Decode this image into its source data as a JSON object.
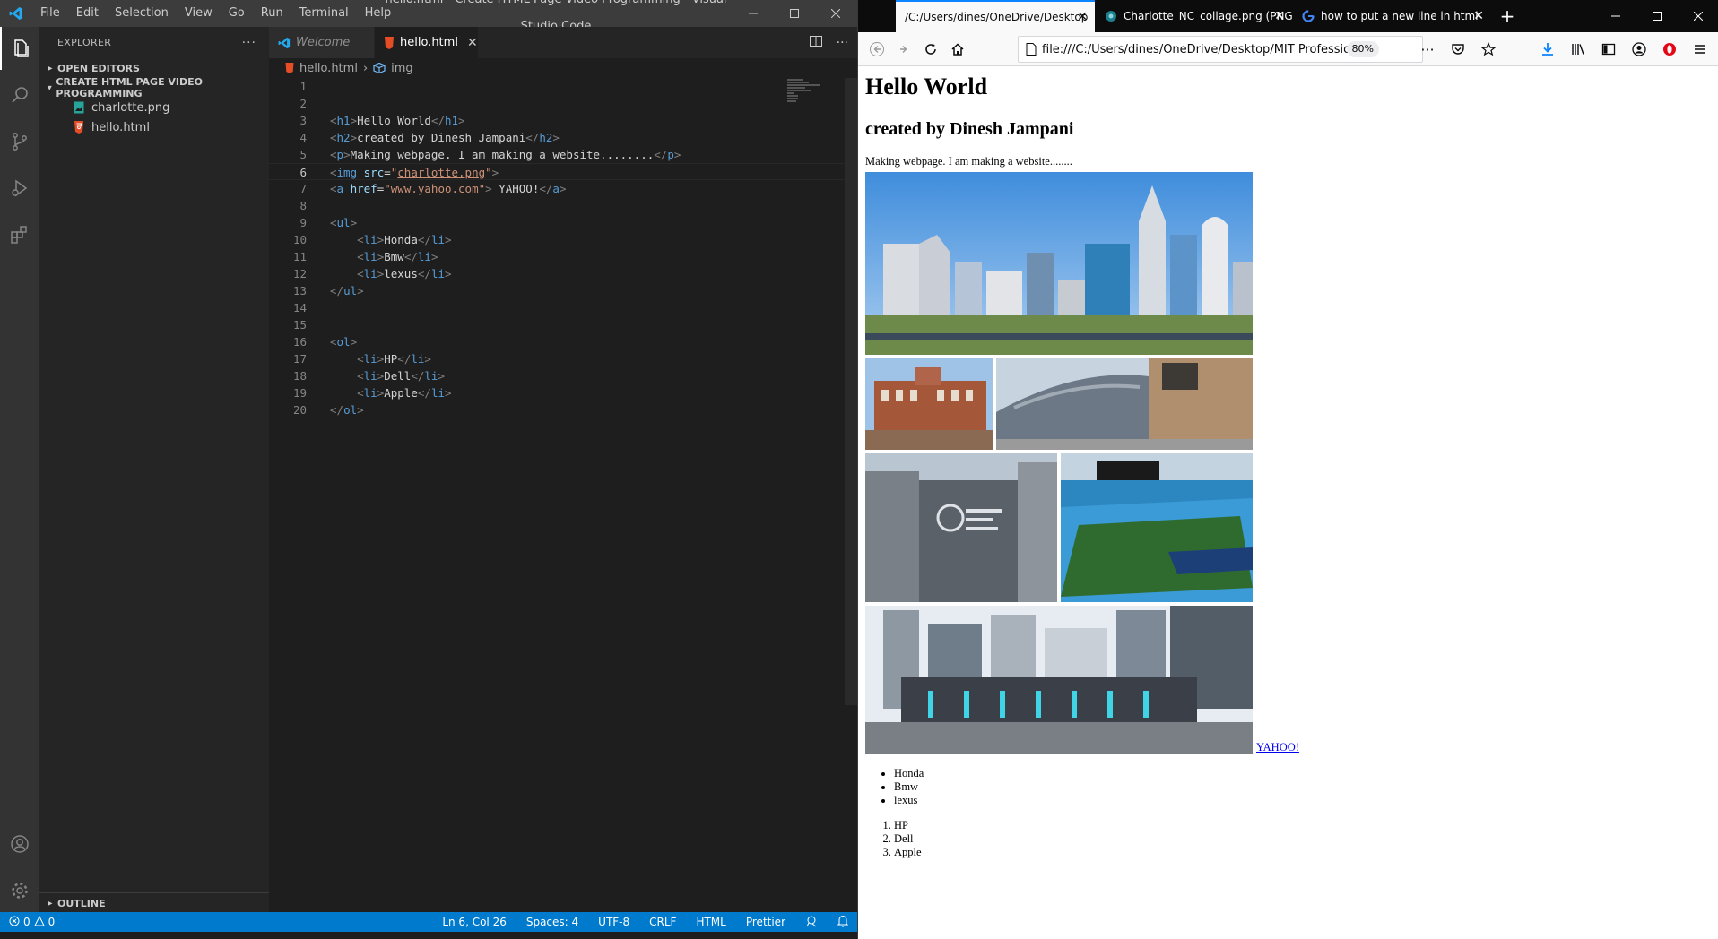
{
  "vscode": {
    "menu": [
      "File",
      "Edit",
      "Selection",
      "View",
      "Go",
      "Run",
      "Terminal",
      "Help"
    ],
    "window_title": "hello.html - Create HTML Page Video Programming - Visual Studio Code",
    "sidebar": {
      "title": "EXPLORER",
      "open_editors": "OPEN EDITORS",
      "project": "CREATE HTML PAGE VIDEO PROGRAMMING",
      "files": [
        {
          "name": "charlotte.png",
          "icon": "image-file-icon"
        },
        {
          "name": "hello.html",
          "icon": "html-file-icon"
        }
      ],
      "outline": "OUTLINE"
    },
    "tabs": [
      {
        "label": "Welcome",
        "active": false
      },
      {
        "label": "hello.html",
        "active": true
      }
    ],
    "breadcrumb": {
      "file": "hello.html",
      "symbol": "img"
    },
    "code": {
      "cursor_line": 6,
      "lines": [
        "",
        "",
        "<h1>Hello World</h1>",
        "<h2>created by Dinesh Jampani</h2>",
        "<p>Making webpage. I am making a website........</p>",
        "<img src=\"charlotte.png\">",
        "<a href=\"www.yahoo.com\"> YAHOO!</a>",
        "",
        "<ul>",
        "    <li>Honda</li>",
        "    <li>Bmw</li>",
        "    <li>lexus</li>",
        "</ul>",
        "",
        "",
        "<ol>",
        "    <li>HP</li>",
        "    <li>Dell</li>",
        "    <li>Apple</li>",
        "</ol>"
      ]
    },
    "status": {
      "errors": "0",
      "warnings": "0",
      "position": "Ln 6, Col 26",
      "spaces": "Spaces: 4",
      "encoding": "UTF-8",
      "eol": "CRLF",
      "language": "HTML",
      "formatter": "Prettier"
    }
  },
  "firefox": {
    "tabs": [
      {
        "label": "/C:/Users/dines/OneDrive/Desktop",
        "active": true
      },
      {
        "label": "Charlotte_NC_collage.png (PNG",
        "active": false
      },
      {
        "label": "how to put a new line in html",
        "active": false
      }
    ],
    "url": "file:///C:/Users/dines/OneDrive/Desktop/MIT Professional",
    "zoom": "80%",
    "page": {
      "h1": "Hello World",
      "h2": "created by Dinesh Jampani",
      "p": "Making webpage. I am making a website........",
      "link": "YAHOO!",
      "ul": [
        "Honda",
        "Bmw",
        "lexus"
      ],
      "ol": [
        "HP",
        "Dell",
        "Apple"
      ]
    }
  },
  "colors": {
    "vscode_bg": "#1e1e1e",
    "statusbar": "#007acc",
    "firefox_tabbar": "#0c0c0d",
    "tab_accent": "#0a84ff",
    "link": "#0000ee"
  }
}
